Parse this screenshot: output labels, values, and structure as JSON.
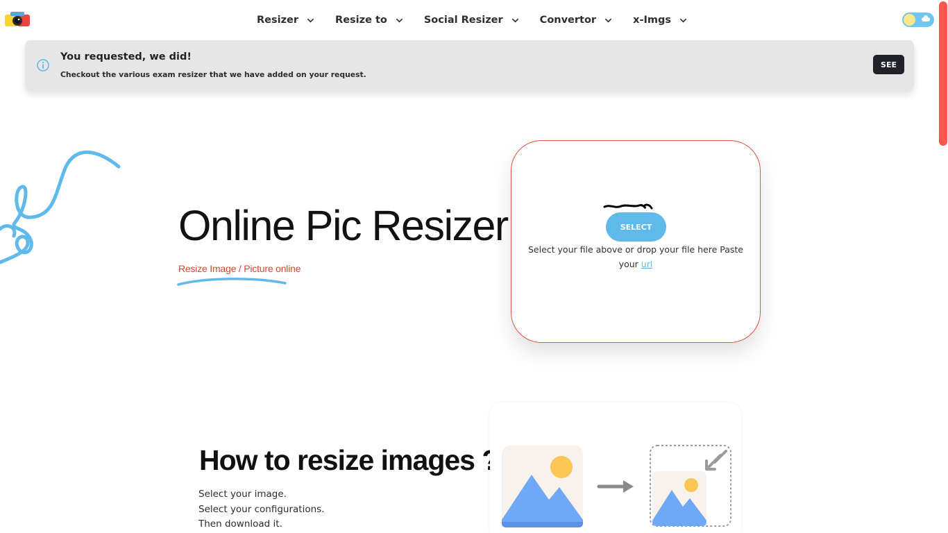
{
  "nav": {
    "items": [
      {
        "label": "Resizer"
      },
      {
        "label": "Resize to"
      },
      {
        "label": "Social Resizer"
      },
      {
        "label": "Convertor"
      },
      {
        "label": "x-Imgs"
      }
    ]
  },
  "banner": {
    "title": "You requested, we did!",
    "text": "Checkout the various exam resizer that we have added on your request.",
    "button": "SEE"
  },
  "hero": {
    "title": "Online Pic Resizer",
    "subtitle": "Resize Image / Picture online"
  },
  "upload": {
    "button": "SELECT",
    "text_before_link": "Select your file above or drop your file here Paste your ",
    "link_text": "url"
  },
  "how": {
    "title": "How to resize images ?",
    "steps": [
      "Select your image.",
      "Select your configurations.",
      "Then download it."
    ]
  },
  "colors": {
    "accent_red": "#e0523c",
    "accent_blue": "#5fb9ea",
    "scroll_thumb": "#f4594b",
    "banner_bg": "#e6e6e6"
  }
}
